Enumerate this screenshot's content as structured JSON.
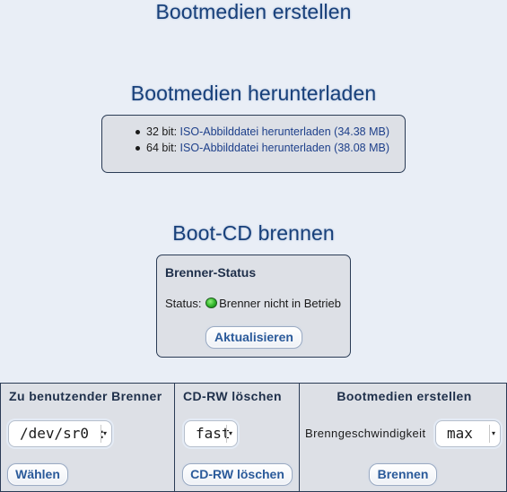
{
  "headings": {
    "create_boot_media": "Bootmedien erstellen",
    "download_boot_media": "Bootmedien herunterladen",
    "burn_boot_cd": "Boot-CD brennen"
  },
  "downloads": [
    {
      "bits": "32 bit:",
      "link": "ISO-Abbilddatei herunterladen (34.38 MB)"
    },
    {
      "bits": "64 bit:",
      "link": "ISO-Abbilddatei herunterladen (38.08 MB)"
    }
  ],
  "burner_status": {
    "title": "Brenner-Status",
    "status_label": "Status:",
    "status_text": "Brenner nicht in Betrieb",
    "status_color": "#2fb42a",
    "refresh_button": "Aktualisieren"
  },
  "bottom": {
    "burner": {
      "title": "Zu benutzender Brenner",
      "device_value": "/dev/sr0 :",
      "select_button": "Wählen"
    },
    "erase": {
      "title": "CD-RW löschen",
      "mode_value": "fast",
      "erase_button": "CD-RW löschen"
    },
    "create": {
      "title": "Bootmedien erstellen",
      "speed_label": "Brenngeschwindigkeit",
      "speed_value": "max",
      "burn_button": "Brennen"
    }
  },
  "colors": {
    "heading": "#18407a",
    "panel_bg": "#dde0e6",
    "page_bg": "#e9eef6",
    "link": "#1d3f8a",
    "button_text": "#2a5a9a"
  }
}
